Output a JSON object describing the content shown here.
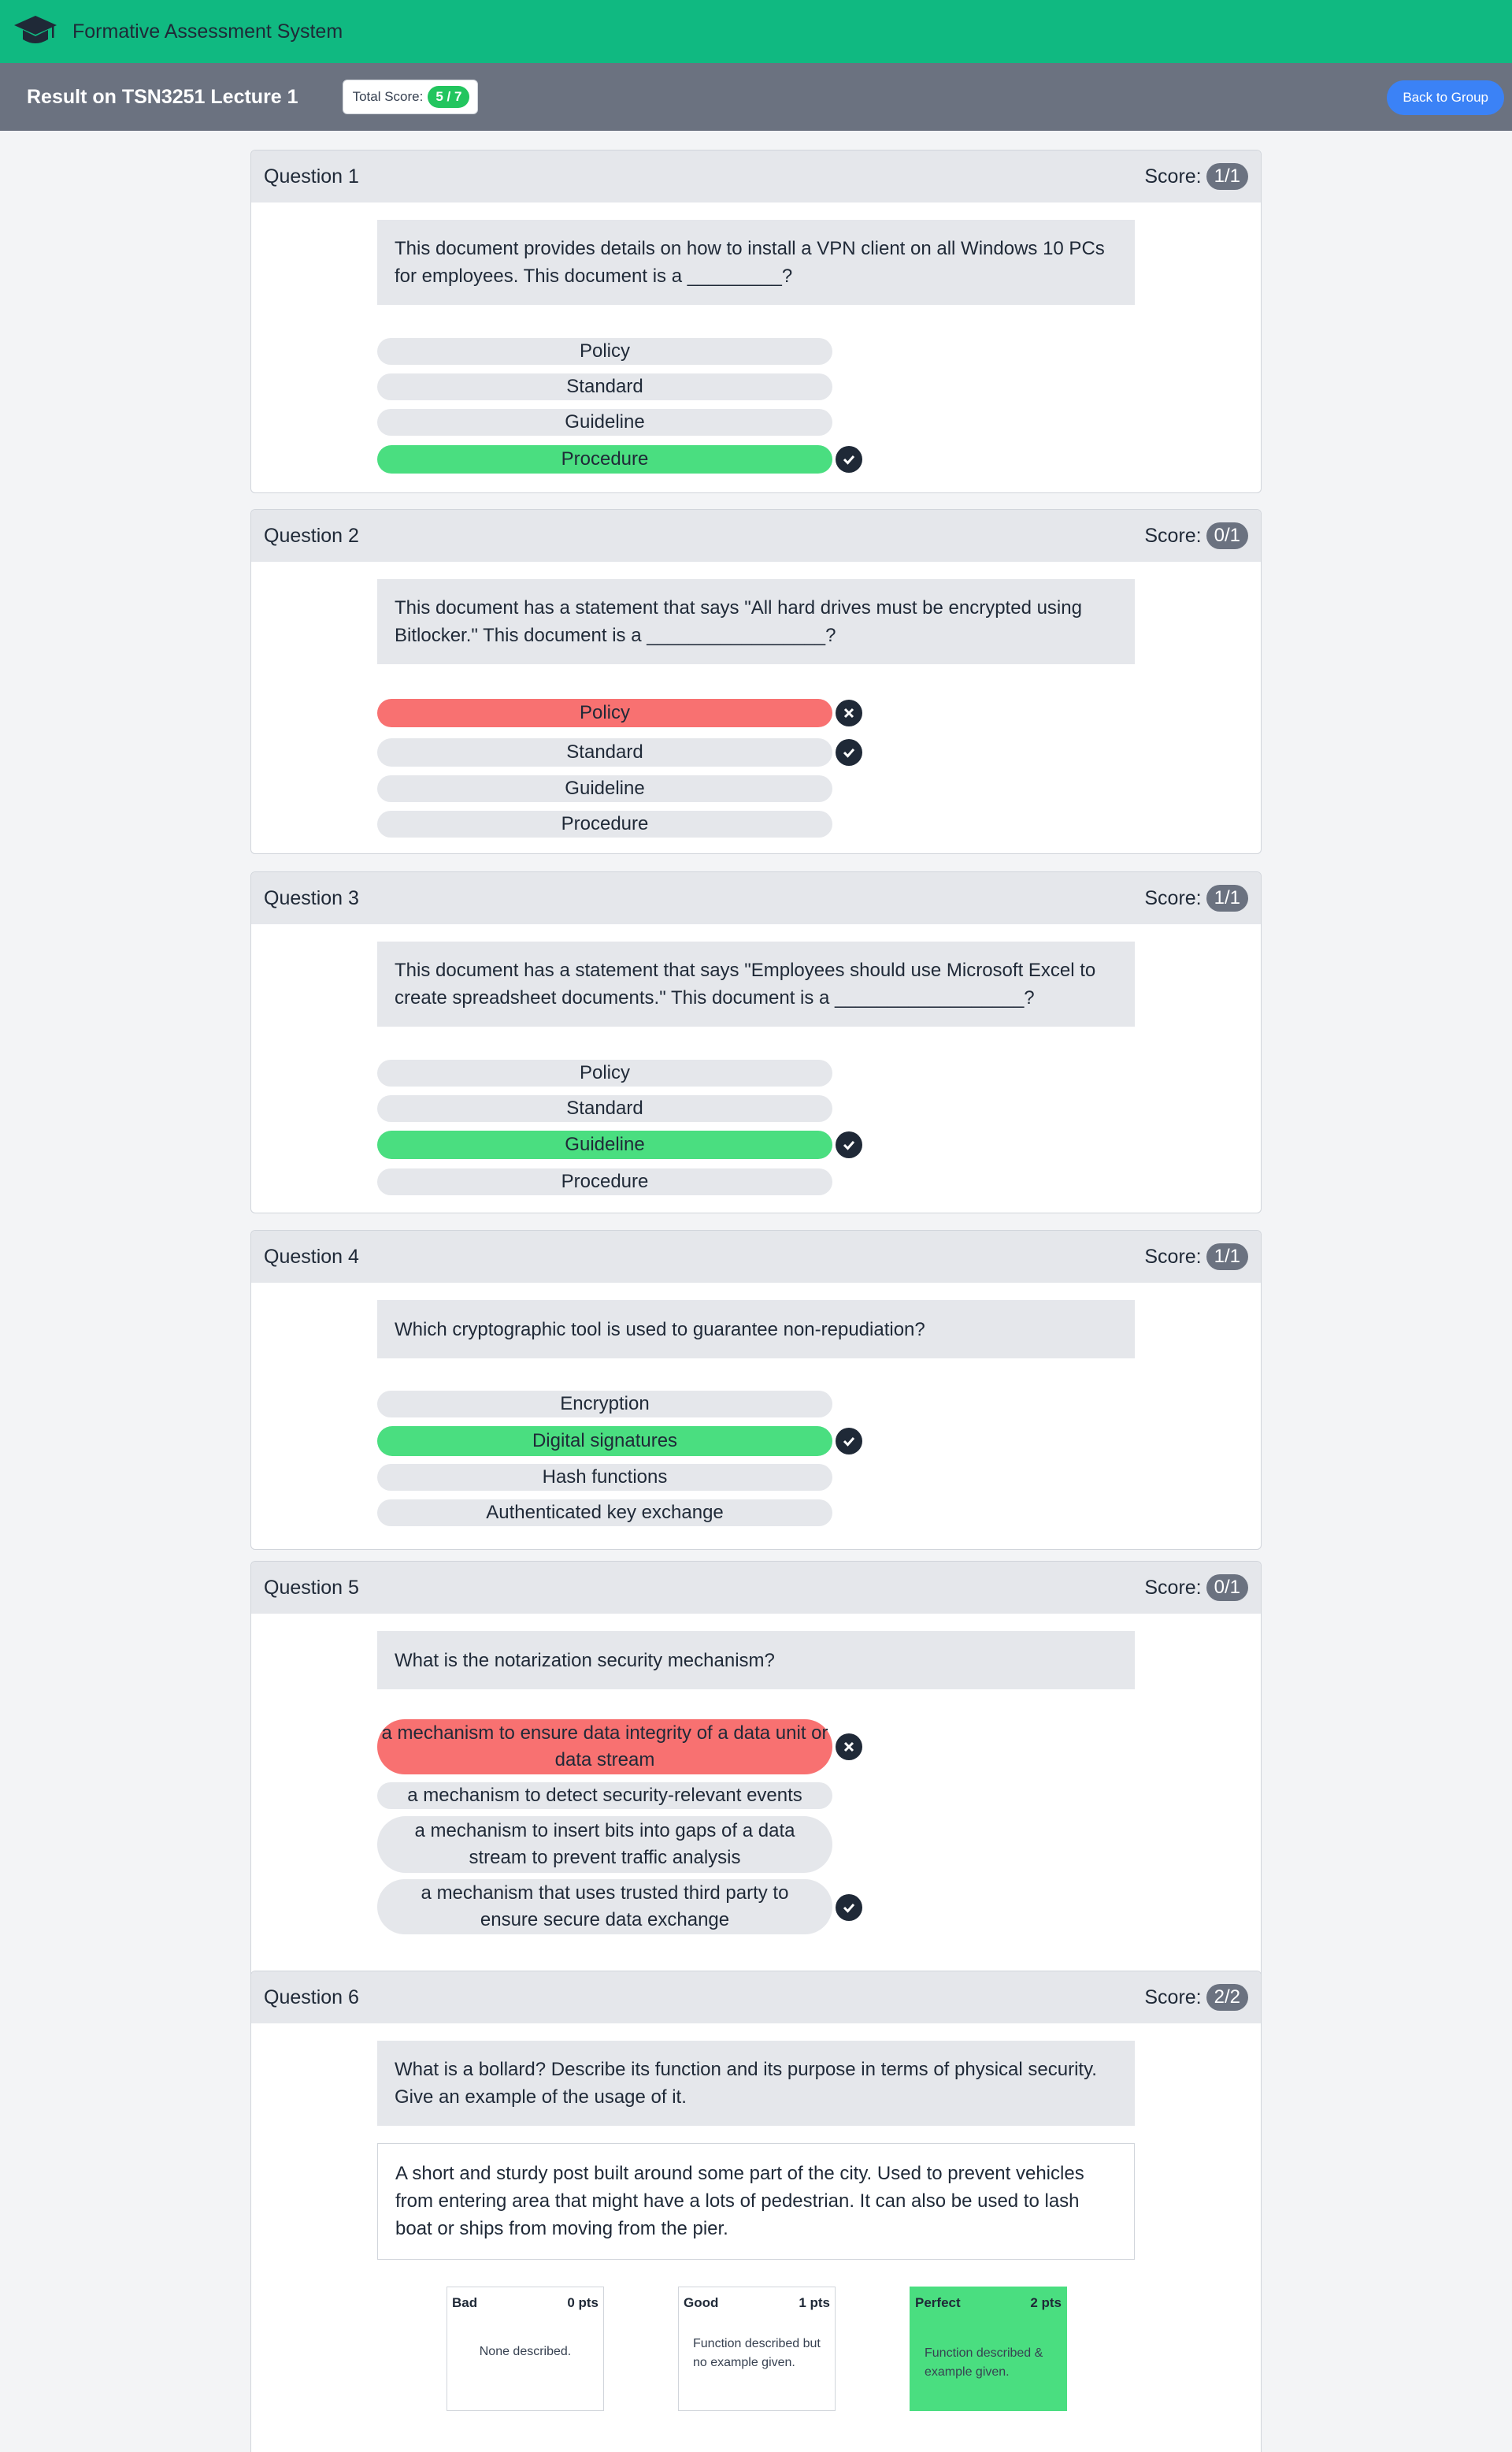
{
  "app": {
    "title": "Formative Assessment System",
    "logo": "graduation-cap-icon"
  },
  "header": {
    "result_title": "Result on TSN3251 Lecture 1",
    "total_score_label": "Total Score:",
    "total_score_value": "5 / 7",
    "back_button": "Back to Group"
  },
  "score_label": "Score:",
  "questions": [
    {
      "title": "Question 1",
      "score": "1/1",
      "prompt": "This document provides details on how to install a VPN client on all Windows 10 PCs for employees. This document is a _________?",
      "options": [
        {
          "label": "Policy",
          "state": "none",
          "mark": ""
        },
        {
          "label": "Standard",
          "state": "none",
          "mark": ""
        },
        {
          "label": "Guideline",
          "state": "none",
          "mark": ""
        },
        {
          "label": "Procedure",
          "state": "correct",
          "mark": "check-icon"
        }
      ]
    },
    {
      "title": "Question 2",
      "score": "0/1",
      "prompt": "This document has a statement that says \"All hard drives must be encrypted using Bitlocker.\" This document is a _________________?",
      "options": [
        {
          "label": "Policy",
          "state": "wrong",
          "mark": "cross-icon"
        },
        {
          "label": "Standard",
          "state": "none",
          "mark": "check-icon"
        },
        {
          "label": "Guideline",
          "state": "none",
          "mark": ""
        },
        {
          "label": "Procedure",
          "state": "none",
          "mark": ""
        }
      ]
    },
    {
      "title": "Question 3",
      "score": "1/1",
      "prompt": "This document has a statement that says \"Employees should use Microsoft Excel to create spreadsheet documents.\" This document is a __________________?",
      "options": [
        {
          "label": "Policy",
          "state": "none",
          "mark": ""
        },
        {
          "label": "Standard",
          "state": "none",
          "mark": ""
        },
        {
          "label": "Guideline",
          "state": "correct",
          "mark": "check-icon"
        },
        {
          "label": "Procedure",
          "state": "none",
          "mark": ""
        }
      ]
    },
    {
      "title": "Question 4",
      "score": "1/1",
      "prompt": "Which cryptographic tool is used to guarantee non-repudiation?",
      "options": [
        {
          "label": "Encryption",
          "state": "none",
          "mark": ""
        },
        {
          "label": "Digital signatures",
          "state": "correct",
          "mark": "check-icon"
        },
        {
          "label": "Hash functions",
          "state": "none",
          "mark": ""
        },
        {
          "label": "Authenticated key exchange",
          "state": "none",
          "mark": ""
        }
      ]
    },
    {
      "title": "Question 5",
      "score": "0/1",
      "prompt": "What is the notarization security mechanism?",
      "options": [
        {
          "label": "a mechanism to ensure data integrity of a data unit or data stream",
          "state": "wrong",
          "mark": "cross-icon"
        },
        {
          "label": "a mechanism to detect security-relevant events",
          "state": "none",
          "mark": ""
        },
        {
          "label": "a mechanism to insert bits into gaps of a data stream to prevent traffic analysis",
          "state": "none",
          "mark": ""
        },
        {
          "label": "a mechanism that uses trusted third party to ensure secure data exchange",
          "state": "none",
          "mark": "check-icon"
        }
      ]
    },
    {
      "title": "Question 6",
      "score": "2/2",
      "prompt": "What is a bollard? Describe its function and its purpose in terms of physical security. Give an example of the usage of it.",
      "answer": "A short and sturdy post built around some part of the city. Used to prevent vehicles from entering area that might have a lots of pedestrian. It can also be used to lash boat or ships from moving from the pier.",
      "rubric": [
        {
          "name": "Bad",
          "points": "0 pts",
          "description": "None described.",
          "selected": false
        },
        {
          "name": "Good",
          "points": "1 pts",
          "description": "Function described but no example given.",
          "selected": false
        },
        {
          "name": "Perfect",
          "points": "2 pts",
          "description": "Function described & example given.",
          "selected": true
        }
      ]
    }
  ]
}
